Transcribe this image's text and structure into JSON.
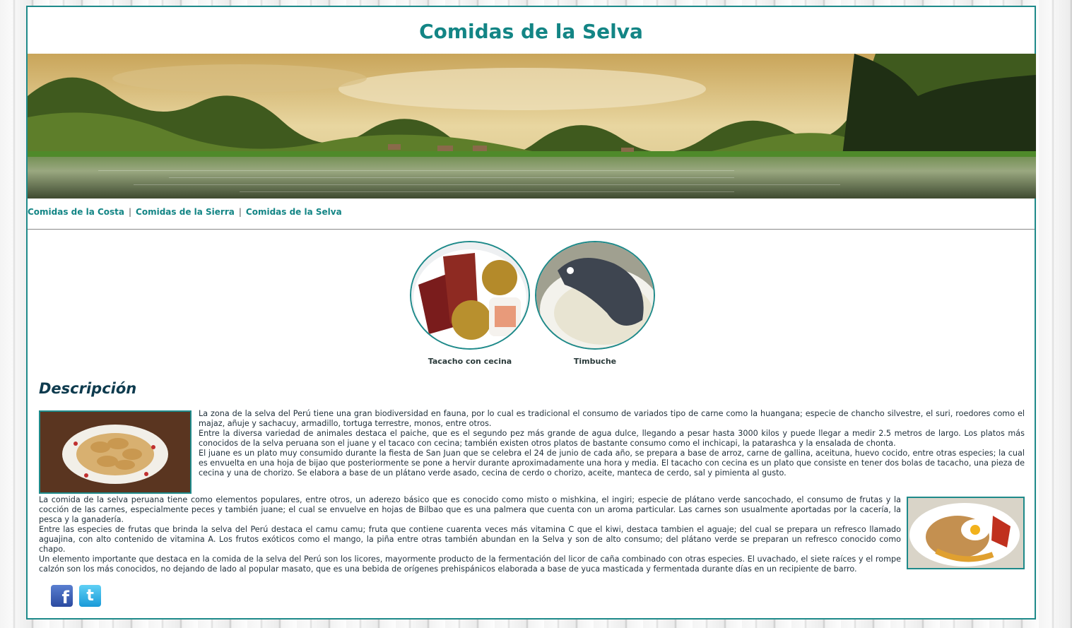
{
  "header": {
    "title": "Comidas de la Selva"
  },
  "nav": {
    "items": [
      {
        "label": "Comidas de la Costa"
      },
      {
        "label": "Comidas de la Sierra"
      },
      {
        "label": "Comidas de la Selva"
      }
    ],
    "separator": "|"
  },
  "dishes": [
    {
      "caption": "Tacacho con cecina"
    },
    {
      "caption": "Timbuche"
    }
  ],
  "description": {
    "heading": "Descripción",
    "p1": "La zona de la selva del Perú tiene una gran biodiversidad en fauna, por lo cual es tradicional el consumo de variados tipo de carne como la huangana; especie de chancho silvestre, el suri, roedores como el majaz, añuje y sachacuy, armadillo, tortuga terrestre, monos, entre otros.",
    "p2": "Entre la diversa variedad de animales destaca el paiche, que es el segundo pez más grande de agua dulce, llegando a pesar hasta 3000 kilos y puede llegar a medir 2.5 metros de largo. Los platos más conocidos de la selva peruana son el juane y el tacaco con cecina; también existen otros platos de bastante consumo como el inchicapi, la patarashca y la ensalada de chonta.",
    "p3": "El juane es un plato muy consumido durante la fiesta de San Juan que se celebra el 24 de junio de cada año, se prepara a base de arroz, carne de gallina, aceituna, huevo cocido, entre otras especies; la cual es envuelta en una hoja de bijao que posteriormente se pone a hervir durante aproximadamente una hora y media. El tacacho con cecina es un plato que consiste en tener dos bolas de tacacho, una pieza de cecina y una de chorizo. Se elabora a base de un plátano verde asado, cecina de cerdo o chorizo, aceite, manteca de cerdo, sal y pimienta al gusto.",
    "p4": "La comida de la selva peruana tiene como elementos populares, entre otros, un aderezo básico que es conocido como misto o mishkina, el ingiri; especie de plátano verde sancochado, el consumo de frutas y la cocción de las carnes, especialmente peces y también juane; el cual se envuelve en hojas de Bilbao que es una palmera que cuenta con un aroma particular. Las carnes son usualmente aportadas por la cacería, la pesca y la ganadería.",
    "p5": "Entre las especies de frutas que brinda la selva del Perú destaca el camu camu; fruta que contiene cuarenta veces más vitamina C que el kiwi, destaca tambien el aguaje; del cual se prepara un refresco llamado aguajina, con alto contenido de vitamina A. Los frutos exóticos como el mango, la piña entre otras también abundan en la Selva y son de alto consumo; del plátano verde se preparan un refresco conocido como chapo.",
    "p6": "Un elemento importante que destaca en la comida de la selva del Perú son los licores, mayormente producto de la fermentación del licor de caña combinado con otras especies. El uvachado, el siete raíces y el rompe calzón son los más conocidos, no dejando de lado al popular masato, que es una bebida de orígenes prehispánicos elaborada a base de yuca masticada y fermentada durante días en un recipiente de barro."
  },
  "social": {
    "icons": [
      "facebook-icon",
      "twitter-icon"
    ],
    "facebook_glyph": "f",
    "twitter_glyph": "t"
  },
  "colors": {
    "accent": "#1e8a8a",
    "title": "#138585",
    "heading": "#0e3b4e"
  }
}
